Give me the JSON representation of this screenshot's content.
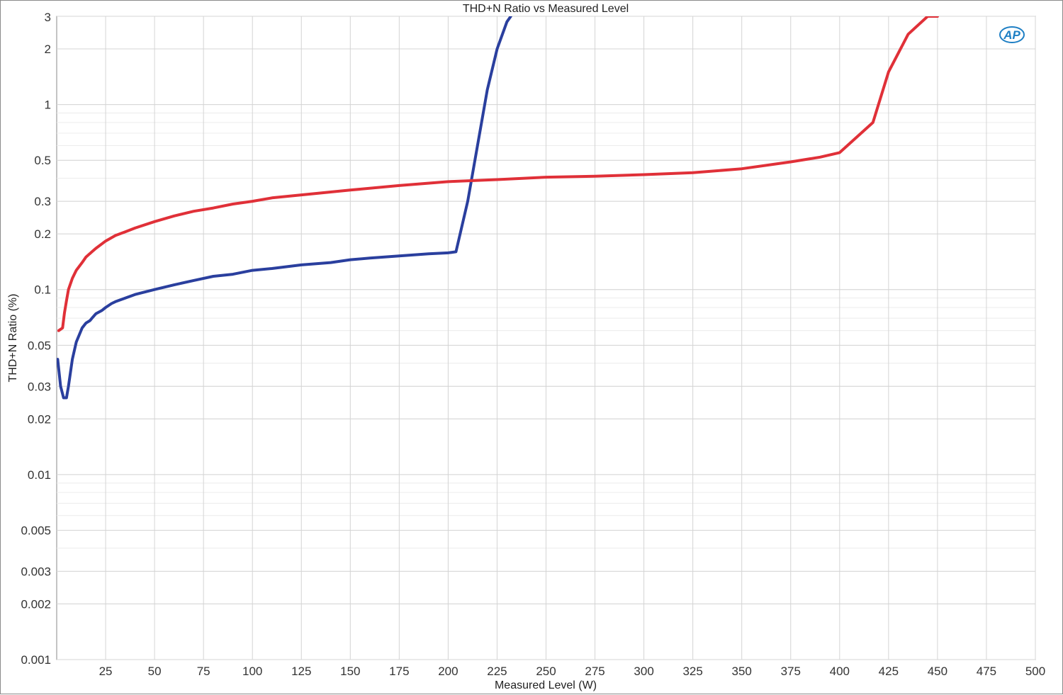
{
  "chart_data": {
    "type": "line",
    "title": "THD+N Ratio vs Measured Level",
    "xlabel": "Measured Level (W)",
    "ylabel": "THD+N Ratio (%)",
    "xlim": [
      0,
      500
    ],
    "ylim": [
      0.001,
      3
    ],
    "y_scale": "log",
    "grid": true,
    "x_ticks": [
      25,
      50,
      75,
      100,
      125,
      150,
      175,
      200,
      225,
      250,
      275,
      300,
      325,
      350,
      375,
      400,
      425,
      450,
      475,
      500
    ],
    "x_tick_labels": [
      "25",
      "50",
      "75",
      "100",
      "125",
      "150",
      "175",
      "200",
      "225",
      "250",
      "275",
      "300",
      "325",
      "350",
      "375",
      "400",
      "425",
      "450",
      "475",
      "500"
    ],
    "y_ticks": [
      0.001,
      0.002,
      0.003,
      0.005,
      0.01,
      0.02,
      0.03,
      0.05,
      0.1,
      0.2,
      0.3,
      0.5,
      1,
      2,
      3
    ],
    "y_tick_labels": [
      "0.001",
      "0.002",
      "0.003",
      "0.005",
      "0.01",
      "0.02",
      "0.03",
      "0.05",
      "0.1",
      "0.2",
      "0.3",
      "0.5",
      "1",
      "2",
      "3"
    ],
    "logo": "AP",
    "series": [
      {
        "color": "#2a3f9e",
        "x": [
          0.5,
          2,
          3.5,
          5,
          6,
          8,
          10,
          13,
          15,
          17,
          18,
          20,
          23,
          25,
          28,
          30,
          35,
          40,
          45,
          50,
          60,
          70,
          80,
          90,
          100,
          110,
          125,
          140,
          150,
          160,
          175,
          190,
          200,
          204,
          210,
          215,
          220,
          225,
          230,
          232
        ],
        "y": [
          0.042,
          0.03,
          0.026,
          0.026,
          0.03,
          0.042,
          0.052,
          0.062,
          0.066,
          0.068,
          0.07,
          0.074,
          0.077,
          0.08,
          0.084,
          0.086,
          0.09,
          0.094,
          0.097,
          0.1,
          0.106,
          0.112,
          0.118,
          0.121,
          0.127,
          0.13,
          0.136,
          0.14,
          0.145,
          0.148,
          0.152,
          0.156,
          0.158,
          0.16,
          0.3,
          0.6,
          1.2,
          2.0,
          2.8,
          3.0
        ]
      },
      {
        "color": "#e03038",
        "x": [
          1,
          3,
          4,
          5,
          6,
          8,
          10,
          13,
          15,
          18,
          20,
          25,
          30,
          35,
          40,
          50,
          60,
          70,
          80,
          90,
          100,
          110,
          125,
          150,
          175,
          200,
          225,
          250,
          275,
          300,
          325,
          350,
          375,
          390,
          400,
          417,
          425,
          435,
          445,
          450
        ],
        "y": [
          0.06,
          0.062,
          0.075,
          0.087,
          0.1,
          0.115,
          0.127,
          0.14,
          0.15,
          0.16,
          0.167,
          0.183,
          0.196,
          0.205,
          0.215,
          0.233,
          0.25,
          0.265,
          0.276,
          0.29,
          0.3,
          0.313,
          0.325,
          0.345,
          0.365,
          0.383,
          0.393,
          0.405,
          0.41,
          0.418,
          0.428,
          0.45,
          0.49,
          0.52,
          0.55,
          0.8,
          1.5,
          2.4,
          3.0,
          3.0
        ]
      }
    ]
  }
}
